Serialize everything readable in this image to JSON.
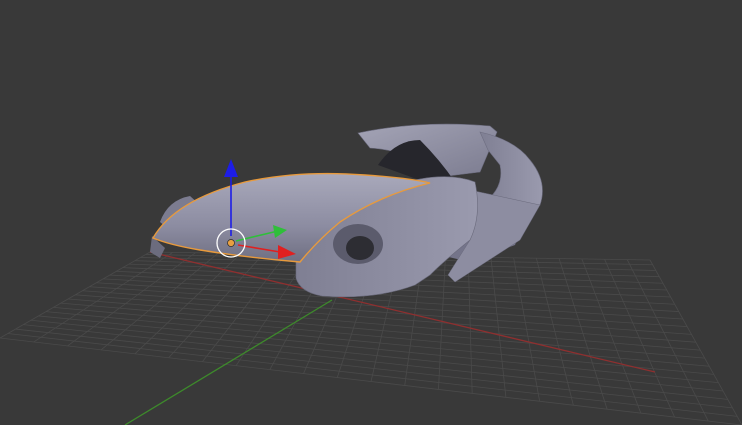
{
  "viewport": {
    "background": "#393939",
    "grid_color": "#4a4a4a",
    "axis_x_color": "#8f2f2f",
    "axis_y_color": "#3d8a2b"
  },
  "object": {
    "type": "car-body-mesh",
    "surface_color": "#8f8fa3",
    "highlight_color": "#b3b3c4",
    "shadow_color": "#5e5e6e",
    "selection_outline_color": "#e89a3c",
    "selected_part": "hood"
  },
  "gizmo": {
    "x_arrow_color": "#e02020",
    "y_arrow_color": "#2fbf3a",
    "z_arrow_color": "#1d1de6",
    "origin_color": "#e8a040",
    "ring_color": "#ffffff"
  }
}
